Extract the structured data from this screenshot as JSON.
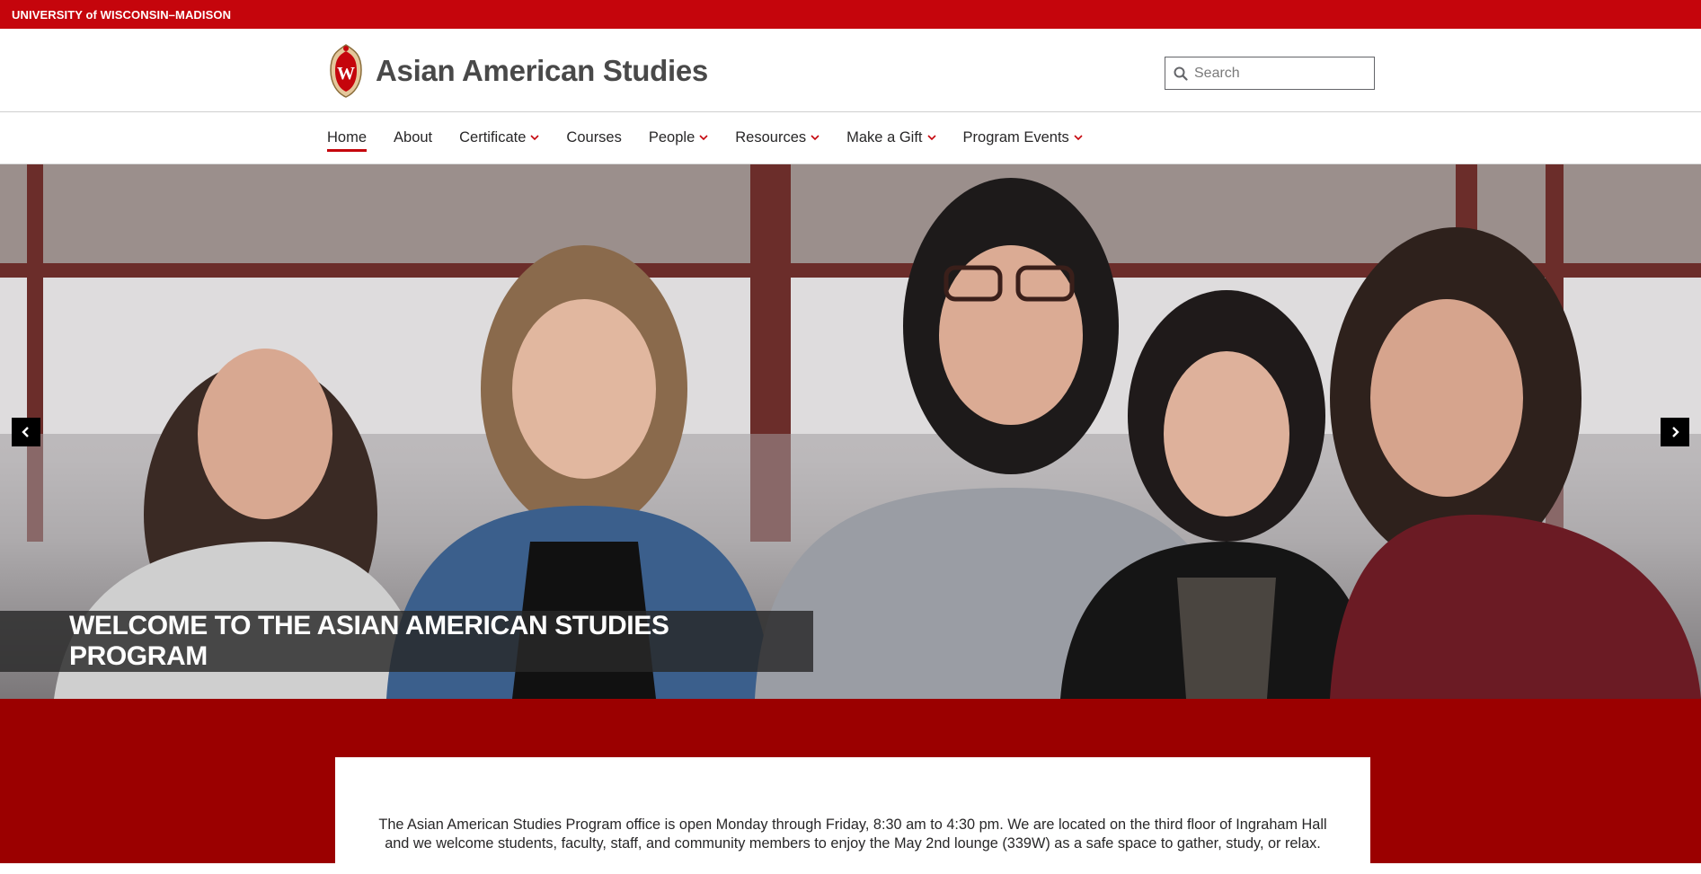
{
  "topbar": {
    "university": "UNIVERSITY of WISCONSIN–MADISON"
  },
  "header": {
    "site_title": "Asian American Studies",
    "crest_icon": "uw-crest-icon"
  },
  "search": {
    "placeholder": "Search"
  },
  "nav": {
    "items": [
      {
        "label": "Home",
        "active": true,
        "has_dropdown": false
      },
      {
        "label": "About",
        "active": false,
        "has_dropdown": false
      },
      {
        "label": "Certificate",
        "active": false,
        "has_dropdown": true
      },
      {
        "label": "Courses",
        "active": false,
        "has_dropdown": false
      },
      {
        "label": "People",
        "active": false,
        "has_dropdown": true
      },
      {
        "label": "Resources",
        "active": false,
        "has_dropdown": true
      },
      {
        "label": "Make a Gift",
        "active": false,
        "has_dropdown": true
      },
      {
        "label": "Program Events",
        "active": false,
        "has_dropdown": true
      }
    ]
  },
  "hero": {
    "caption": "WELCOME TO THE ASIAN AMERICAN STUDIES PROGRAM",
    "prev_icon": "chevron-left-icon",
    "next_icon": "chevron-right-icon"
  },
  "intro": {
    "line1": "The Asian American Studies Program office is open Monday through Friday, 8:30 am to 4:30 pm. We are located on the third floor of Ingraham Hall",
    "line2": "and we welcome students, faculty, staff, and community members to enjoy the May 2nd lounge (339W) as a safe space to gather, study, or relax."
  },
  "colors": {
    "brand_red": "#c5050c",
    "band_red": "#9b0000",
    "text": "#282728"
  }
}
